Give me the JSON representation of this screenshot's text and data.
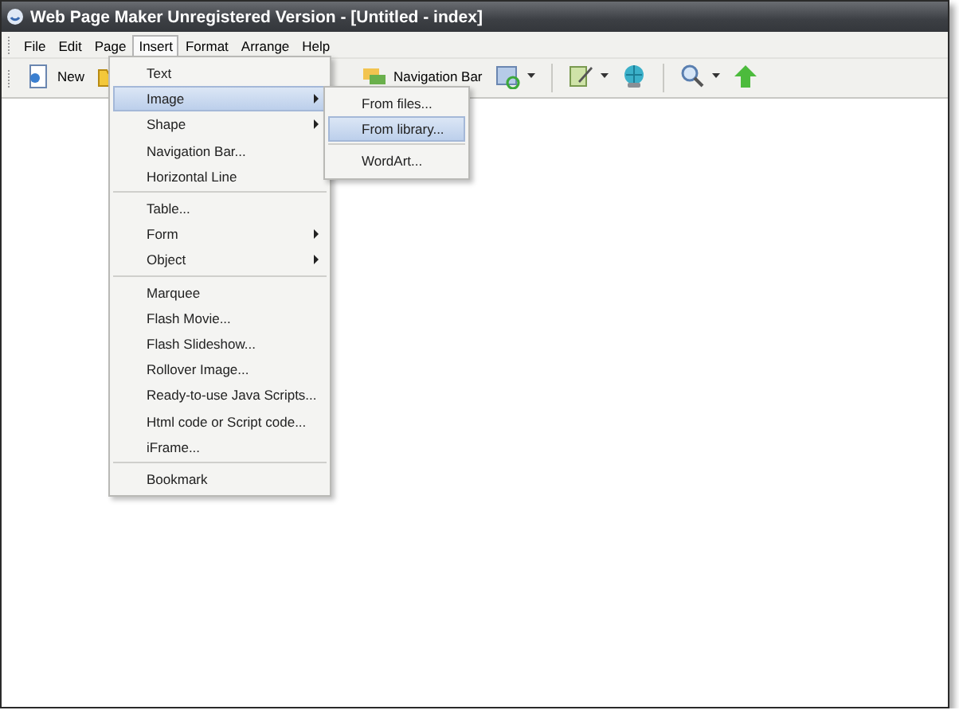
{
  "window": {
    "title": "Web Page Maker Unregistered Version - [Untitled - index]"
  },
  "menubar": [
    {
      "label": "File",
      "selected": false
    },
    {
      "label": "Edit",
      "selected": false
    },
    {
      "label": "Page",
      "selected": false
    },
    {
      "label": "Insert",
      "selected": true
    },
    {
      "label": "Format",
      "selected": false
    },
    {
      "label": "Arrange",
      "selected": false
    },
    {
      "label": "Help",
      "selected": false
    }
  ],
  "toolbar": [
    {
      "kind": "labeled",
      "label": "New",
      "dropdown": false
    },
    {
      "kind": "icon",
      "dropdown": false
    },
    {
      "kind": "gap"
    },
    {
      "kind": "labeled",
      "label": "Navigation Bar",
      "dropdown": false
    },
    {
      "kind": "icon",
      "dropdown": true
    },
    {
      "kind": "separator"
    },
    {
      "kind": "icon",
      "dropdown": true
    },
    {
      "kind": "icon",
      "dropdown": false
    },
    {
      "kind": "separator"
    },
    {
      "kind": "icon",
      "dropdown": true
    },
    {
      "kind": "icon",
      "dropdown": false
    }
  ],
  "insert_menu": [
    {
      "kind": "item",
      "label": "Text",
      "submenu": false,
      "selected": false
    },
    {
      "kind": "item",
      "label": "Image",
      "submenu": true,
      "selected": true
    },
    {
      "kind": "item",
      "label": "Shape",
      "submenu": true,
      "selected": false
    },
    {
      "kind": "item",
      "label": "Navigation Bar...",
      "submenu": false,
      "selected": false
    },
    {
      "kind": "item",
      "label": "Horizontal Line",
      "submenu": false,
      "selected": false
    },
    {
      "kind": "separator"
    },
    {
      "kind": "item",
      "label": "Table...",
      "submenu": false,
      "selected": false
    },
    {
      "kind": "item",
      "label": "Form",
      "submenu": true,
      "selected": false
    },
    {
      "kind": "item",
      "label": "Object",
      "submenu": true,
      "selected": false
    },
    {
      "kind": "separator"
    },
    {
      "kind": "item",
      "label": "Marquee",
      "submenu": false,
      "selected": false
    },
    {
      "kind": "item",
      "label": "Flash Movie...",
      "submenu": false,
      "selected": false
    },
    {
      "kind": "item",
      "label": "Flash Slideshow...",
      "submenu": false,
      "selected": false
    },
    {
      "kind": "item",
      "label": "Rollover Image...",
      "submenu": false,
      "selected": false
    },
    {
      "kind": "item",
      "label": "Ready-to-use Java Scripts...",
      "submenu": false,
      "selected": false
    },
    {
      "kind": "item",
      "label": "Html code or Script code...",
      "submenu": false,
      "selected": false
    },
    {
      "kind": "item",
      "label": "iFrame...",
      "submenu": false,
      "selected": false
    },
    {
      "kind": "separator"
    },
    {
      "kind": "item",
      "label": "Bookmark",
      "submenu": false,
      "selected": false
    }
  ],
  "image_submenu": [
    {
      "kind": "item",
      "label": "From files...",
      "submenu": false,
      "selected": false
    },
    {
      "kind": "item",
      "label": "From library...",
      "submenu": false,
      "selected": true
    },
    {
      "kind": "separator"
    },
    {
      "kind": "item",
      "label": "WordArt...",
      "submenu": false,
      "selected": false
    }
  ]
}
